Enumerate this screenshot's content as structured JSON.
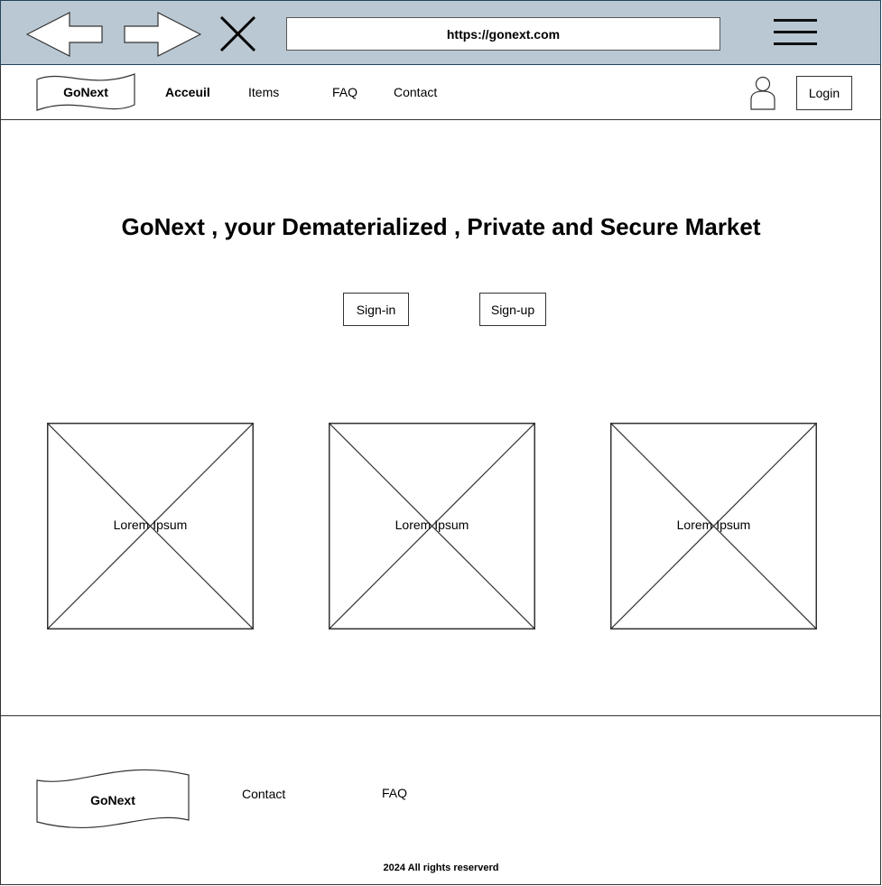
{
  "browser": {
    "url": "https://gonext.com",
    "back_icon": "back-arrow-icon",
    "forward_icon": "forward-arrow-icon",
    "close_icon": "close-icon",
    "menu_icon": "hamburger-menu-icon"
  },
  "navbar": {
    "logo": "GoNext",
    "links": [
      "Acceuil",
      "Items",
      "FAQ",
      "Contact"
    ],
    "user_icon": "user-icon",
    "login_label": "Login"
  },
  "hero": {
    "title": "GoNext , your Dematerialized , Private and Secure Market",
    "signin_label": "Sign-in",
    "signup_label": "Sign-up"
  },
  "cards": [
    {
      "label": "Lorem Ipsum"
    },
    {
      "label": "Lorem Ipsum"
    },
    {
      "label": "Lorem Ipsum"
    }
  ],
  "footer": {
    "logo": "GoNext",
    "links": [
      "Contact",
      "FAQ"
    ],
    "copyright": "2024 All rights reserverd"
  },
  "colors": {
    "browser_bar": "#bac8d3",
    "border": "#333333"
  }
}
